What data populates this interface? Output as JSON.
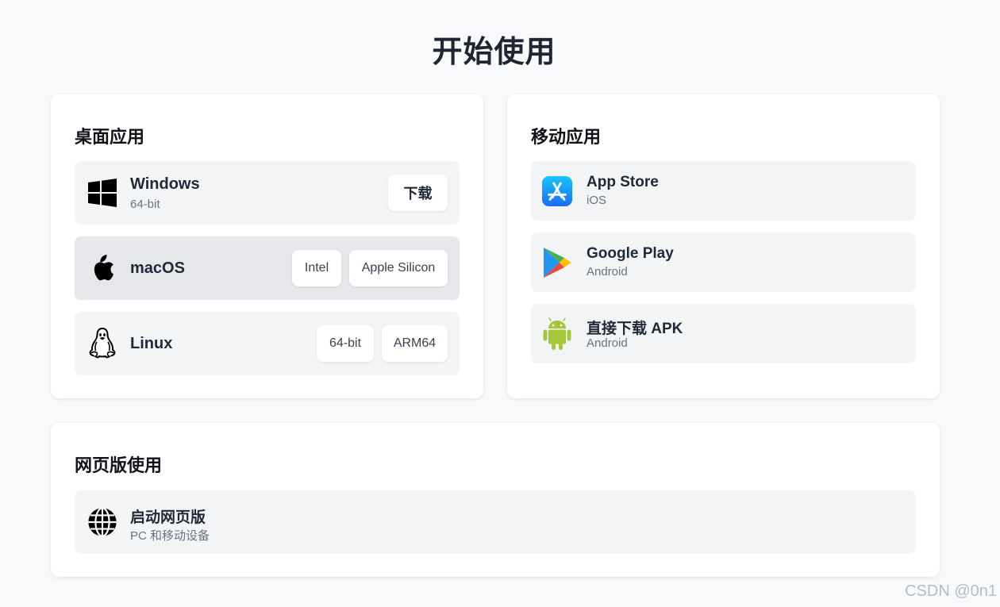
{
  "page": {
    "title": "开始使用"
  },
  "desktop": {
    "title": "桌面应用",
    "windows": {
      "name": "Windows",
      "sub": "64-bit",
      "download": "下载"
    },
    "macos": {
      "name": "macOS",
      "intel": "Intel",
      "apple_silicon": "Apple Silicon"
    },
    "linux": {
      "name": "Linux",
      "x64": "64-bit",
      "arm64": "ARM64"
    }
  },
  "mobile": {
    "title": "移动应用",
    "appstore": {
      "name": "App Store",
      "sub": "iOS"
    },
    "googleplay": {
      "name": "Google Play",
      "sub": "Android"
    },
    "apk": {
      "name": "直接下载 APK",
      "sub": "Android"
    }
  },
  "web": {
    "title": "网页版使用",
    "launch": {
      "name": "启动网页版",
      "sub": "PC 和移动设备"
    }
  },
  "watermark": "CSDN @0n1",
  "icons": [
    "windows-icon",
    "apple-icon",
    "linux-icon",
    "app-store-icon",
    "google-play-icon",
    "android-icon",
    "globe-icon"
  ],
  "colors": {
    "background": "#f8f9fb",
    "card": "#ffffff",
    "row": "#f3f4f6",
    "row_active": "#e5e7eb",
    "app_store_blue": "#1a8cf8",
    "android_green": "#a4c639"
  }
}
